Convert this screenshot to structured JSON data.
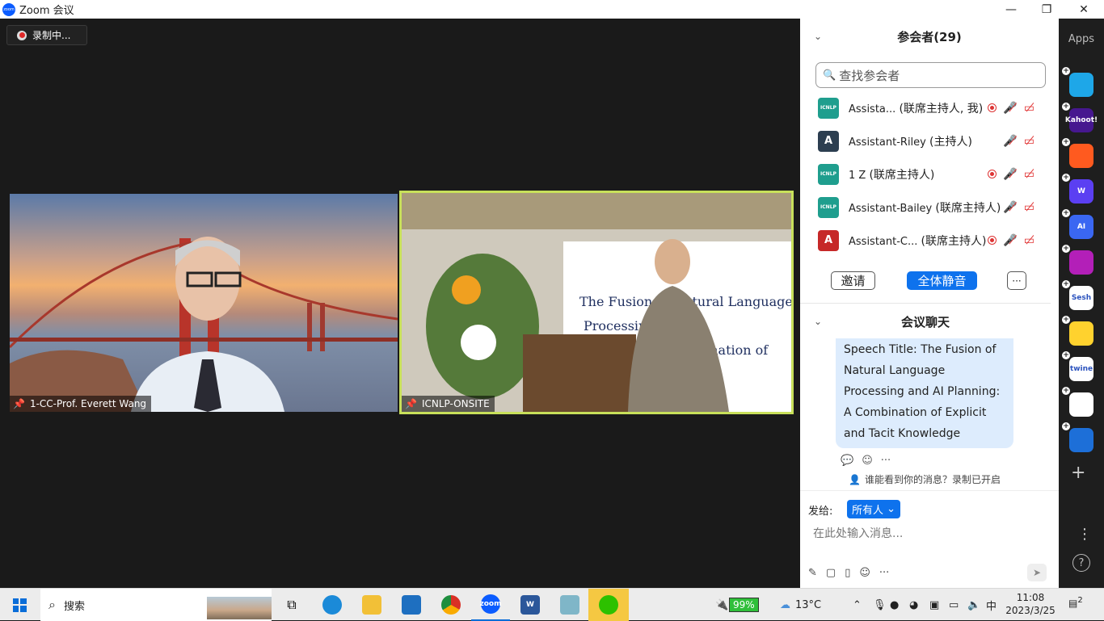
{
  "window": {
    "title": "Zoom 会议",
    "app_icon_label": "zoom"
  },
  "stage": {
    "recording_label": "录制中...",
    "tiles": [
      {
        "name": "1-CC-Prof. Everett Wang"
      },
      {
        "name": "ICNLP-ONSITE"
      }
    ]
  },
  "participants": {
    "header": "参会者(29)",
    "search_placeholder": "查找参会者",
    "items": [
      {
        "avatar": "ICNLP",
        "name": "Assista...",
        "role": "(联席主持人, 我)",
        "recording": true
      },
      {
        "avatar": "A",
        "name": "Assistant-Riley",
        "role": "(主持人)",
        "recording": false
      },
      {
        "avatar": "ICNLP",
        "name": "1 Z",
        "role": "(联席主持人)",
        "recording": true
      },
      {
        "avatar": "ICNLP",
        "name": "Assistant-Bailey",
        "role": "(联席主持人)",
        "recording": false
      },
      {
        "avatar": "A",
        "name": "Assistant-C...",
        "role": "(联席主持人)",
        "recording": true
      }
    ],
    "invite_label": "邀请",
    "mute_all_label": "全体静音",
    "more_label": "···"
  },
  "chat": {
    "header": "会议聊天",
    "message": "Speech Title: The Fusion of Natural Language Processing and AI Planning: A Combination of Explicit and Tacit Knowledge",
    "visibility_note": "谁能看到你的消息？录制已开启",
    "send_to_label": "发给:",
    "send_to_value": "所有人",
    "input_placeholder": "在此处输入消息..."
  },
  "apps_panel": {
    "label": "Apps",
    "apps": [
      {
        "icon": "play-app-icon",
        "color": "#1ea7e8",
        "text": ""
      },
      {
        "icon": "kahoot-icon",
        "color": "#46178f",
        "text": "Kahoot!"
      },
      {
        "icon": "orange-app-icon",
        "color": "#ff5a1f",
        "text": ""
      },
      {
        "icon": "w-app-icon",
        "color": "#5b3ff2",
        "text": "W"
      },
      {
        "icon": "ai-app-icon",
        "color": "#3a67f2",
        "text": "AI"
      },
      {
        "icon": "camera-app-icon",
        "color": "#b31fb8",
        "text": ""
      },
      {
        "icon": "sesh-icon",
        "color": "#ffffff",
        "text": "Sesh"
      },
      {
        "icon": "emoji-app-icon",
        "color": "#ffd22e",
        "text": ""
      },
      {
        "icon": "twine-icon",
        "color": "#ffffff",
        "text": "twine"
      },
      {
        "icon": "grid-app-icon",
        "color": "#ffffff",
        "text": ""
      },
      {
        "icon": "sync-app-icon",
        "color": "#1d6fd8",
        "text": ""
      }
    ]
  },
  "taskbar": {
    "search_label": "搜索",
    "battery": "99%",
    "temperature": "13°C",
    "ime": "中",
    "time": "11:08",
    "date": "2023/3/25",
    "notifications": "2"
  },
  "colors": {
    "accent": "#0e72ed",
    "active_speaker": "#c8e05a",
    "muted_red": "#e03030"
  }
}
